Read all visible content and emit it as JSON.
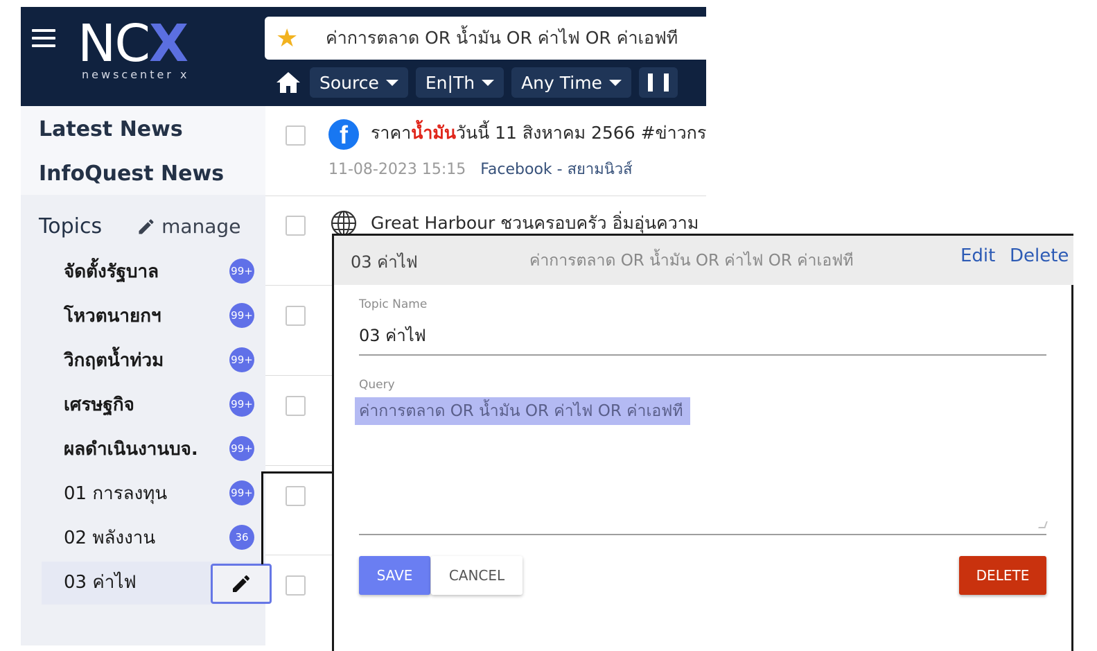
{
  "header": {
    "logo_main": "NC",
    "logo_accent": "X",
    "logo_sub": "newscenter x",
    "search_query": "ค่าการตลาด OR น้ำมัน OR ค่าไฟ OR ค่าเอฟที",
    "filters": [
      {
        "label": "Source"
      },
      {
        "label": "En|Th"
      },
      {
        "label": "Any Time"
      }
    ]
  },
  "sidebar": {
    "links": [
      "Latest News",
      "InfoQuest News"
    ],
    "topics_label": "Topics",
    "manage_label": "manage",
    "topics": [
      {
        "label": "จัดตั้งรัฐบาล",
        "badge": "99+"
      },
      {
        "label": "โหวตนายกฯ",
        "badge": "99+"
      },
      {
        "label": "วิกฤตน้ำท่วม",
        "badge": "99+"
      },
      {
        "label": "เศรษฐกิจ",
        "badge": "99+"
      },
      {
        "label": "ผลดำเนินงานบจ.",
        "badge": "99+"
      },
      {
        "label": "01 การลงทุน",
        "badge": "99+"
      },
      {
        "label": "02 พลังงาน",
        "badge": "36"
      },
      {
        "label": "03 ค่าไฟ"
      }
    ]
  },
  "news": [
    {
      "title_prefix": "ราคา",
      "title_highlight": "น้ำมัน",
      "title_suffix": "วันนี้ 11 สิงหาคม 2566 #ข่าวกร",
      "date": "11-08-2023",
      "time": "15:15",
      "source": "Facebook - สยามนิวส์"
    },
    {
      "title": "Great Harbour ชวนครอบครัว อิ่มอุ่นความ"
    }
  ],
  "dialog": {
    "header_name": "03 ค่าไฟ",
    "header_query": "ค่าการตลาด OR น้ำมัน OR ค่าไฟ OR ค่าเอฟที",
    "edit_label": "Edit",
    "delete_link_label": "Delete",
    "topic_name_label": "Topic Name",
    "topic_name_value": "03 ค่าไฟ",
    "query_label": "Query",
    "query_value": "ค่าการตลาด OR น้ำมัน OR ค่าไฟ OR ค่าเอฟที",
    "save_label": "SAVE",
    "cancel_label": "CANCEL",
    "delete_label": "DELETE"
  },
  "colors": {
    "header_bg": "#10223f",
    "accent": "#5b6fe0",
    "badge": "#6070e8",
    "delete_button": "#c9320e",
    "highlight_text": "#e0251a",
    "query_selection": "#b4baf3"
  },
  "icons": [
    "hamburger-icon",
    "star-icon",
    "home-icon",
    "caret-down-icon",
    "pause-icon",
    "pencil-icon",
    "facebook-icon",
    "globe-icon"
  ]
}
